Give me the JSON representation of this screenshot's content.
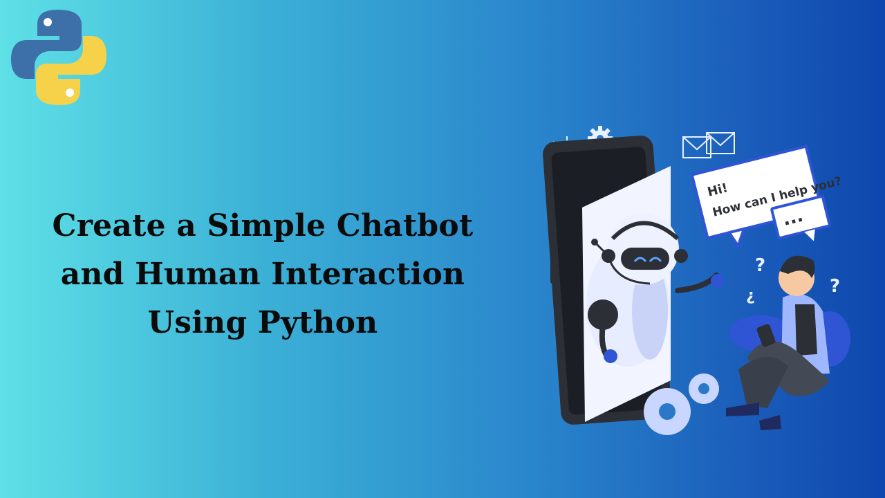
{
  "logo": {
    "icon": "python-logo",
    "colors": {
      "blue": "#3d6fa8",
      "yellow": "#f6d24a"
    }
  },
  "title": {
    "line1": "Create a Simple Chatbot",
    "line2": "and Human Interaction",
    "line3": "Using Python"
  },
  "illustration": {
    "icon": "chatbot-human-illustration",
    "speech_line1": "Hi!",
    "speech_line2": "How can I help you?",
    "typing_dots": "...",
    "question_mark": "?",
    "colors": {
      "dark": "#2c2f36",
      "light": "#f2f5ff",
      "accent": "#2f55d4",
      "skin": "#f6c9a3"
    }
  }
}
